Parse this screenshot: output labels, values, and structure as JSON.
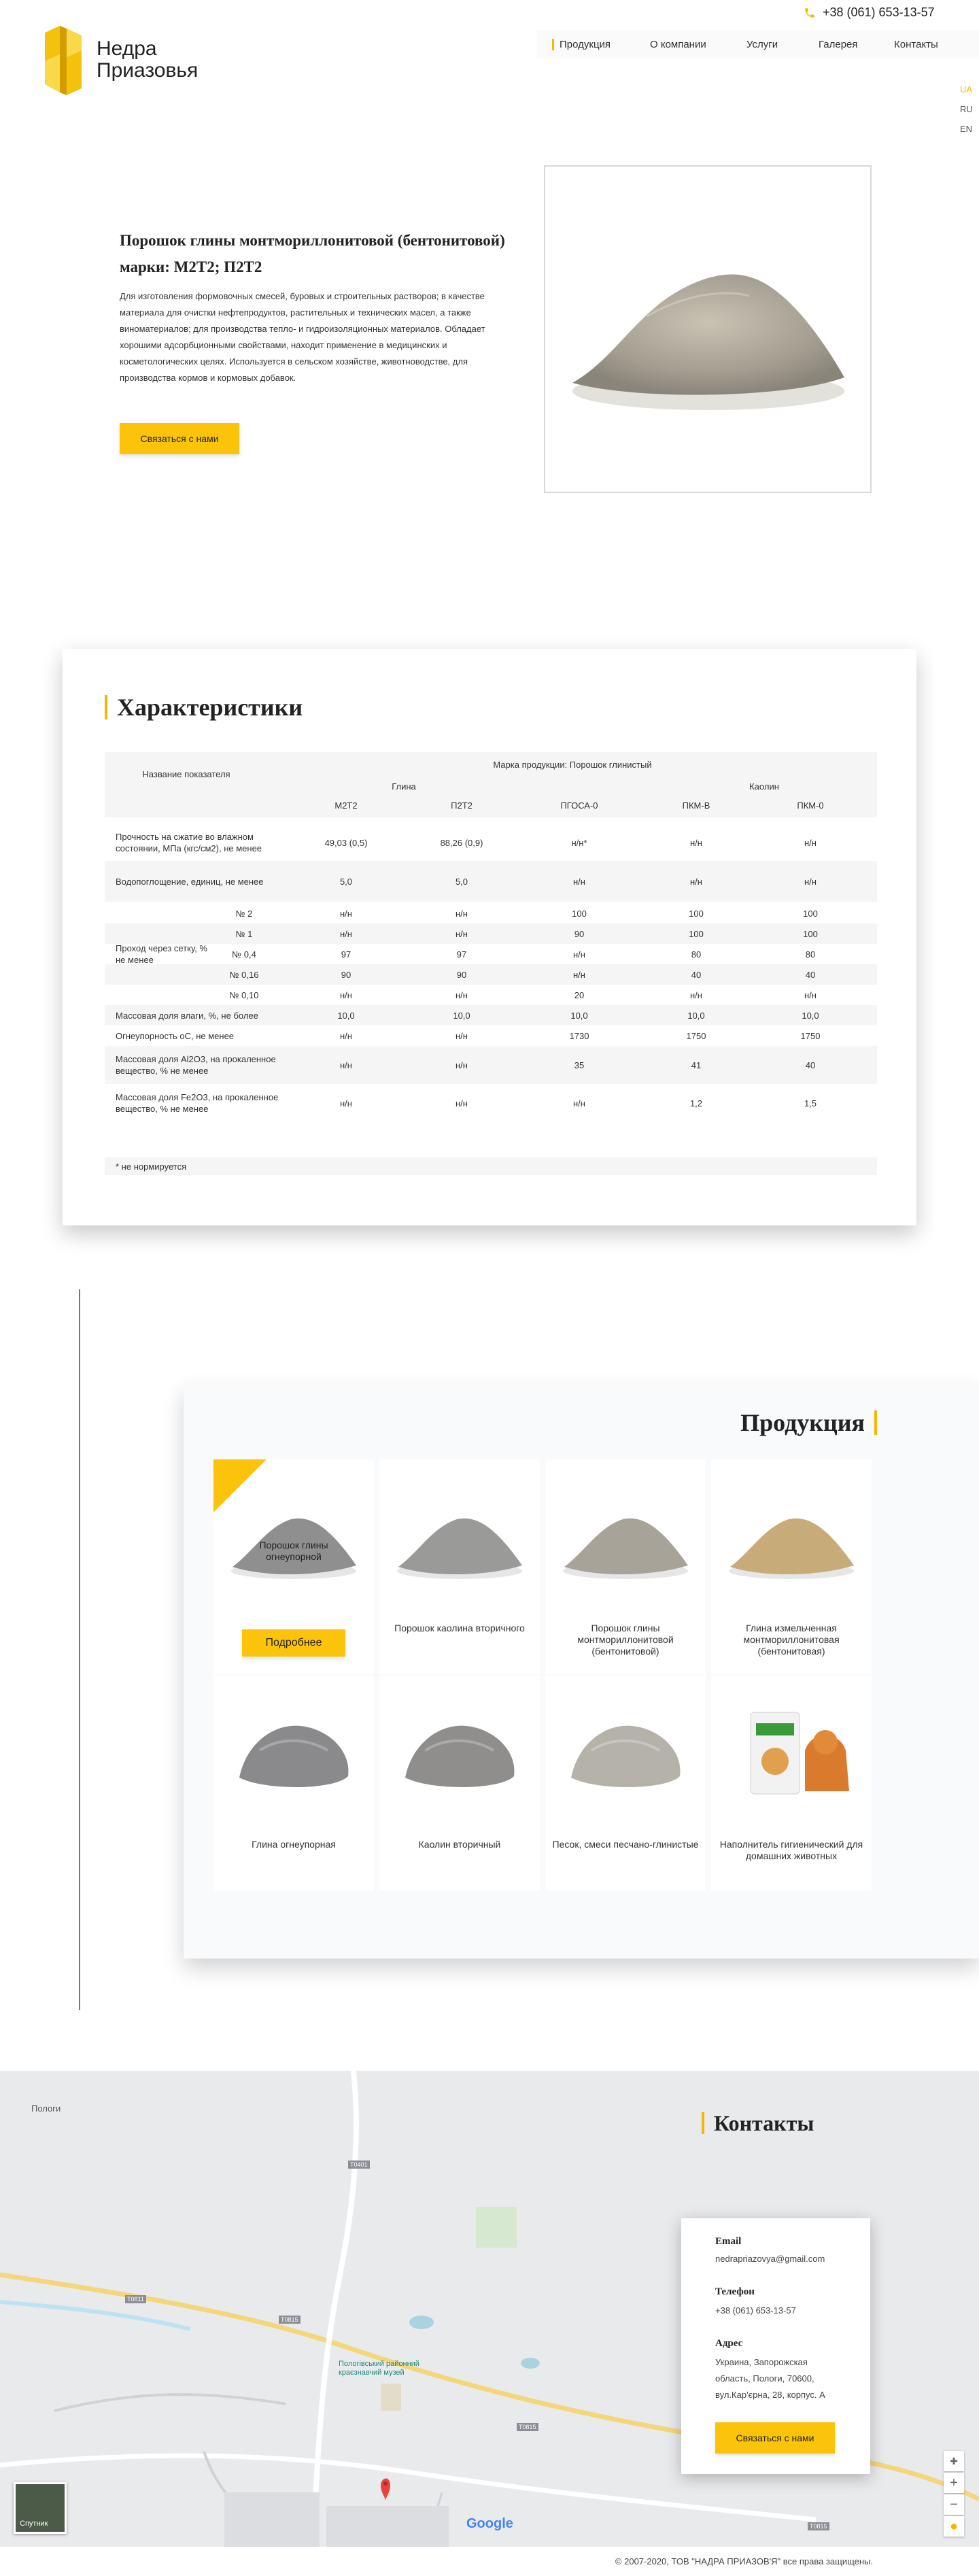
{
  "header": {
    "logo_line1": "Недра",
    "logo_line2": "Приазовья",
    "phone": "+38 (061) 653-13-57",
    "nav": [
      "Продукция",
      "О компании",
      "Услуги",
      "Галерея",
      "Контакты"
    ],
    "languages": [
      "UA",
      "RU",
      "EN"
    ],
    "active_language": "UA"
  },
  "hero": {
    "title": "Порошок глины монтмориллонитовой (бентонитовой) марки: М2Т2; П2Т2",
    "description": "Для изготовления формовочных смесей, буровых и строительных растворов; в качестве материала для очистки нефтепродуктов, растительных и технических масел, а также виноматериалов; для производства тепло- и гидроизоляционных материалов. Обладает хорошими адсорбционными свойствами, находит применение в медицинских и косметологических целях. Используется в сельском хозяйстве, животноводстве, для производства кормов и кормовых добавок.",
    "button": "Связаться с нами"
  },
  "characteristics": {
    "title": "Характеристики",
    "header": {
      "param": "Название показателя",
      "mark": "Марка продукции: Порошок глинистый",
      "group_clay": "Глина",
      "group_kaolin": "Каолин",
      "columns": [
        "М2Т2",
        "П2Т2",
        "ПГОСА-0",
        "ПКМ-В",
        "ПКМ-0"
      ]
    },
    "rows": [
      {
        "name": "Прочность на сжатие во влажном состоянии, МПа (кгс/см2), не менее",
        "values": [
          "49,03 (0,5)",
          "88,26 (0,9)",
          "н/н*",
          "н/н",
          "н/н"
        ]
      },
      {
        "name": "Водопоглощение, единиц, не менее",
        "values": [
          "5,0",
          "5,0",
          "н/н",
          "н/н",
          "н/н"
        ]
      }
    ],
    "sieve_label": "Проход через сетку, % не менее",
    "sieve_rows": [
      {
        "sub": "№ 2",
        "values": [
          "н/н",
          "н/н",
          "100",
          "100",
          "100"
        ]
      },
      {
        "sub": "№ 1",
        "values": [
          "н/н",
          "н/н",
          "90",
          "100",
          "100"
        ]
      },
      {
        "sub": "№ 0,4",
        "values": [
          "97",
          "97",
          "н/н",
          "80",
          "80"
        ]
      },
      {
        "sub": "№ 0,16",
        "values": [
          "90",
          "90",
          "н/н",
          "40",
          "40"
        ]
      },
      {
        "sub": "№ 0,10",
        "values": [
          "н/н",
          "н/н",
          "20",
          "н/н",
          "н/н"
        ]
      }
    ],
    "tail_rows": [
      {
        "name": "Массовая доля влаги, %, не более",
        "values": [
          "10,0",
          "10,0",
          "10,0",
          "10,0",
          "10,0"
        ]
      },
      {
        "name": "Огнеупорность оС, не менее",
        "values": [
          "н/н",
          "н/н",
          "1730",
          "1750",
          "1750"
        ]
      },
      {
        "name": "Массовая доля Al2O3, на прокаленное вещество, % не менее",
        "values": [
          "н/н",
          "н/н",
          "35",
          "41",
          "40"
        ]
      },
      {
        "name": "Массовая доля Fe2O3, на прокаленное вещество, % не менее",
        "values": [
          "н/н",
          "н/н",
          "н/н",
          "1,2",
          "1,5"
        ]
      }
    ],
    "footnote": "* не нормируется"
  },
  "products": {
    "title": "Продукция",
    "more_button": "Подробнее",
    "items": [
      {
        "name": "Порошок глины огнеупорной",
        "image": "clay-powder-gray",
        "color": "#8f8f8f"
      },
      {
        "name": "Порошок каолина вторичного",
        "image": "kaolin-powder",
        "color": "#9a9a98"
      },
      {
        "name": "Порошок глины монтмориллонитовой (бентонитовой)",
        "image": "bentonite-powder",
        "color": "#a8a398"
      },
      {
        "name": "Глина измельченная монтмориллонитовая (бентонитовая)",
        "image": "crushed-clay",
        "color": "#c7ac7a"
      },
      {
        "name": "Глина огнеупорная",
        "image": "refractory-clay-lump",
        "color": "#8a8a8c"
      },
      {
        "name": "Каолин вторичный",
        "image": "kaolin-lump",
        "color": "#8f8e8c"
      },
      {
        "name": "Песок, смеси песчано-глинистые",
        "image": "sand-clay-mix",
        "color": "#b5b2aa"
      },
      {
        "name": "Наполнитель гигиенический для домашних животных",
        "image": "pet-litter-bag",
        "color": "#d97a2c"
      }
    ]
  },
  "contacts": {
    "title": "Контакты",
    "email_label": "Email",
    "email": "nedrapriazovya@gmail.com",
    "phone_label": "Телефон",
    "phone": "+38 (061) 653-13-57",
    "address_label": "Адрес",
    "address": "Украина, Запорожская область, Пологи, 70600, вул.Кар'єрна, 28, корпус. А",
    "button": "Связаться с нами"
  },
  "map": {
    "town_label": "Пологи",
    "museum_label": "Пологівський районний краєзнавчий музей",
    "roads": [
      "T0811",
      "T0401",
      "T0815",
      "T0815",
      "T0815"
    ],
    "satellite_label": "Спутник",
    "google_label": "Google",
    "zoom_in": "+",
    "zoom_out": "−"
  },
  "footer": {
    "copyright": "© 2007-2020, ТОВ \"НАДРА ПРИАЗОВ'Я\" все права защищены."
  },
  "colors": {
    "accent": "#fbc40b",
    "text": "#2b2b2b",
    "table_alt": "#f5f5f5"
  }
}
